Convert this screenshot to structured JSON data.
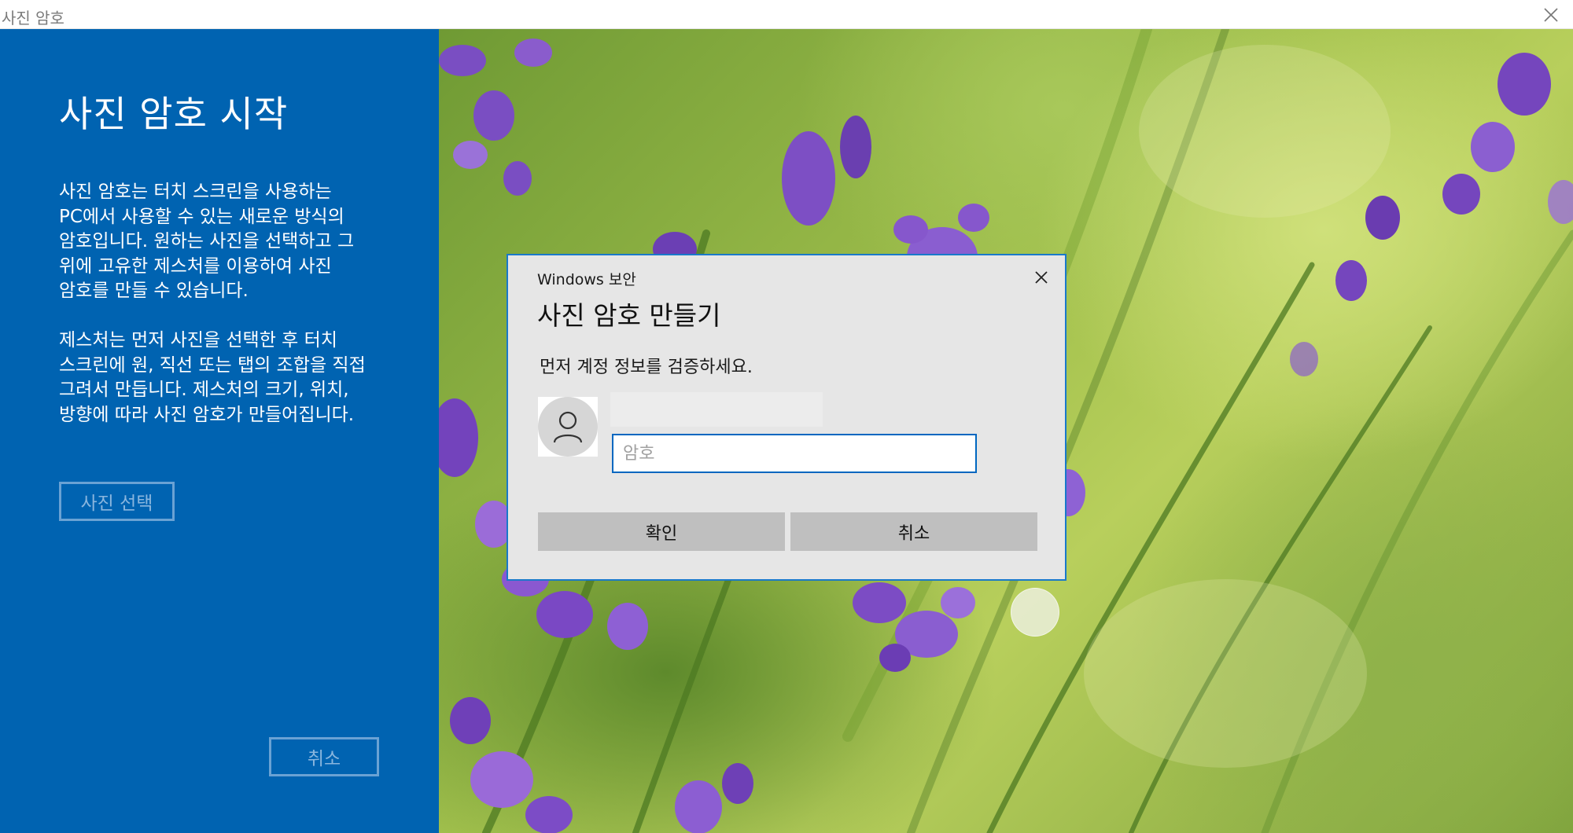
{
  "window": {
    "title": "사진 암호"
  },
  "left_panel": {
    "heading": "사진 암호 시작",
    "paragraph1": "사진 암호는 터치 스크린을 사용하는 PC에서 사용할 수 있는 새로운 방식의 암호입니다. 원하는 사진을 선택하고 그 위에 고유한 제스처를 이용하여 사진 암호를 만들 수 있습니다.",
    "paragraph2": "제스처는 먼저 사진을 선택한 후 터치 스크린에 원, 직선 또는 탭의 조합을 직접 그려서 만듭니다. 제스처의 크기, 위치, 방향에 따라 사진 암호가 만들어집니다.",
    "choose_photo_label": "사진 선택",
    "cancel_label": "취소",
    "background_color": "#0063b1"
  },
  "dialog": {
    "caption": "Windows 보안",
    "title": "사진 암호 만들기",
    "description": "먼저 계정 정보를 검증하세요.",
    "password_placeholder": "암호",
    "password_value": "",
    "ok_label": "확인",
    "cancel_label": "취소",
    "accent_color": "#1979ca"
  },
  "icons": {
    "window_close": "close-icon",
    "dialog_close": "close-icon",
    "avatar": "user-icon"
  }
}
